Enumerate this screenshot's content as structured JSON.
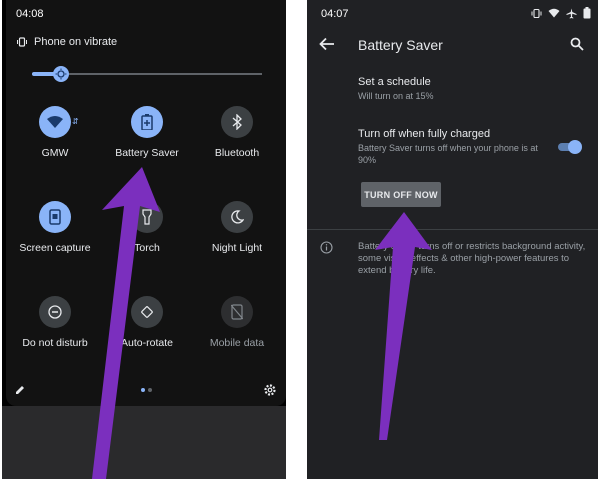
{
  "left": {
    "status_time": "04:08",
    "vibrate_label": "Phone on vibrate",
    "brightness_level": 0.13,
    "tiles": [
      {
        "label": "GMW",
        "state": "on",
        "icon": "wifi-icon"
      },
      {
        "label": "Battery Saver",
        "state": "on",
        "icon": "battery-saver-icon"
      },
      {
        "label": "Bluetooth",
        "state": "off",
        "icon": "bluetooth-icon"
      },
      {
        "label": "Screen capture",
        "state": "on",
        "icon": "screen-capture-icon"
      },
      {
        "label": "Torch",
        "state": "off",
        "icon": "flashlight-icon"
      },
      {
        "label": "Night Light",
        "state": "off",
        "icon": "moon-icon"
      },
      {
        "label": "Do not disturb",
        "state": "off",
        "icon": "dnd-icon"
      },
      {
        "label": "Auto-rotate",
        "state": "off",
        "icon": "rotate-icon"
      },
      {
        "label": "Mobile data",
        "state": "disabled",
        "icon": "mobile-data-off-icon"
      }
    ],
    "page_count": 2,
    "active_page": 1
  },
  "right": {
    "status_time": "04:07",
    "title": "Battery Saver",
    "schedule": {
      "title": "Set a schedule",
      "subtitle": "Will turn on at 15%"
    },
    "turn_off_charged": {
      "title": "Turn off when fully charged",
      "subtitle": "Battery Saver turns off when your phone is at 90%",
      "enabled": true
    },
    "button_label": "TURN OFF NOW",
    "info_text": "Battery Saver turns off or restricts background activity, some visual effects & other high-power features to extend battery life."
  },
  "colors": {
    "accent": "#8ab4f8",
    "annotation_arrow": "#7b2fbe",
    "dark_bg": "#202124"
  }
}
